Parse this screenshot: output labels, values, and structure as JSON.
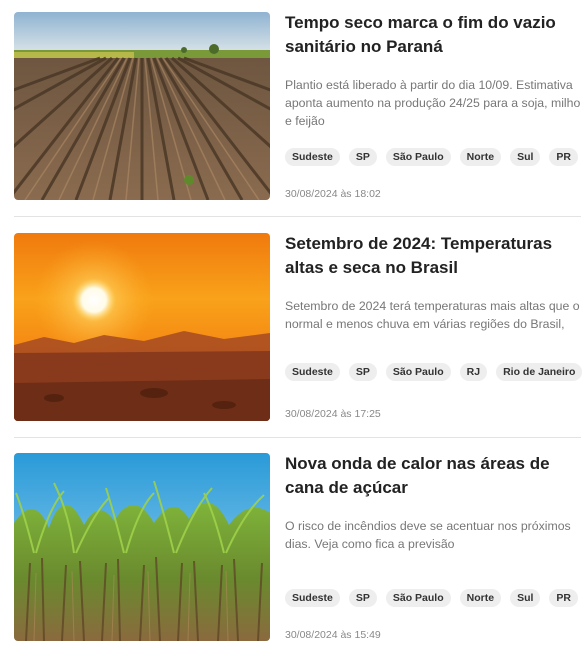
{
  "articles": [
    {
      "image": "plowed-field-image",
      "title": "Tempo seco marca o fim do vazio sanitário no Paraná",
      "summary": "Plantio está liberado à partir do dia 10/09. Estimativa aponta aumento na produção 24/25 para a soja, milho e feijão",
      "tags": [
        "Sudeste",
        "SP",
        "São Paulo",
        "Norte",
        "Sul",
        "PR"
      ],
      "date": "30/08/2024 às 18:02"
    },
    {
      "image": "sunset-sky-image",
      "title": "Setembro de 2024: Temperaturas altas e seca no Brasil",
      "summary": "Setembro de 2024 terá temperaturas mais altas que o normal e menos chuva em várias regiões do Brasil,",
      "tags": [
        "Sudeste",
        "SP",
        "São Paulo",
        "RJ",
        "Rio de Janeiro"
      ],
      "date": "30/08/2024 às 17:25"
    },
    {
      "image": "sugarcane-field-image",
      "title": "Nova onda de calor nas áreas de cana de açúcar",
      "summary": "O risco de incêndios deve se acentuar nos próximos dias. Veja como fica a previsão",
      "tags": [
        "Sudeste",
        "SP",
        "São Paulo",
        "Norte",
        "Sul",
        "PR"
      ],
      "date": "30/08/2024 às 15:49"
    }
  ]
}
